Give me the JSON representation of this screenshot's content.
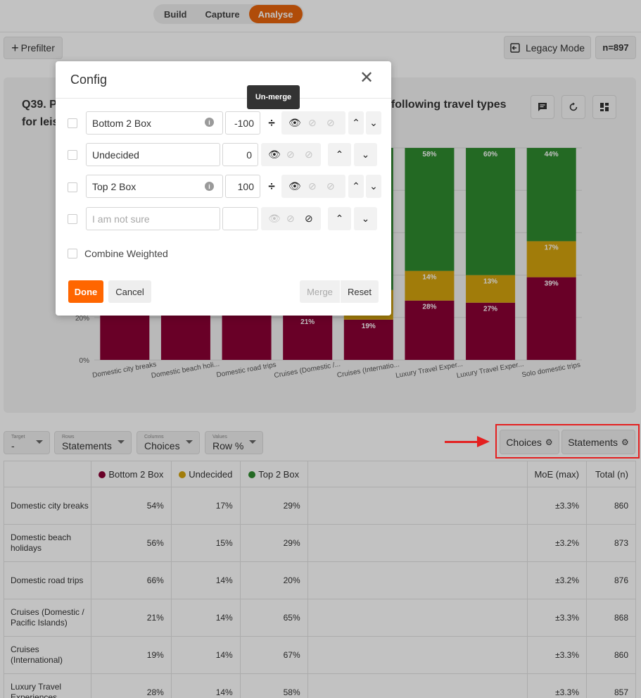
{
  "nav": {
    "tabs": [
      {
        "label": "Build"
      },
      {
        "label": "Capture"
      },
      {
        "label": "Analyse"
      }
    ]
  },
  "toolbar": {
    "prefilter_label": "Prefilter",
    "legacy_label": "Legacy Mode",
    "n_label": "n=897"
  },
  "card": {
    "title": "Q39. P... the following travel types for leis...",
    "title_line1_left": "Q39. P",
    "title_line1_right": "he following travel types",
    "title_line2": "for leis"
  },
  "colors": {
    "bottom2": "#8a0034",
    "undecided": "#d4a40e",
    "top2": "#2e8a2e",
    "accent": "#ff6600"
  },
  "chart_data": {
    "type": "bar",
    "stacked": true,
    "categories": [
      "Domestic city breaks",
      "Domestic beach holi...",
      "Domestic road trips",
      "Cruises (Domestic /...",
      "Cruises (Internatio...",
      "Luxury Travel Exper...",
      "Luxury Travel Exper...",
      "Solo domestic trips"
    ],
    "series": [
      {
        "name": "Bottom 2 Box",
        "values": [
          54,
          56,
          66,
          21,
          19,
          28,
          27,
          39
        ]
      },
      {
        "name": "Undecided",
        "values": [
          17,
          15,
          14,
          14,
          14,
          14,
          13,
          17
        ]
      },
      {
        "name": "Top 2 Box",
        "values": [
          29,
          29,
          20,
          65,
          67,
          58,
          60,
          44
        ]
      }
    ],
    "visible_labels": [
      {
        "cat": 3,
        "series": 0,
        "text": "21%"
      },
      {
        "cat": 4,
        "series": 0,
        "text": "19%"
      },
      {
        "cat": 5,
        "series": 0,
        "text": "28%"
      },
      {
        "cat": 5,
        "series": 1,
        "text": "14%"
      },
      {
        "cat": 5,
        "series": 2,
        "text": "58%"
      },
      {
        "cat": 6,
        "series": 0,
        "text": "27%"
      },
      {
        "cat": 6,
        "series": 1,
        "text": "13%"
      },
      {
        "cat": 6,
        "series": 2,
        "text": "60%"
      },
      {
        "cat": 7,
        "series": 0,
        "text": "39%"
      },
      {
        "cat": 7,
        "series": 1,
        "text": "17%"
      },
      {
        "cat": 7,
        "series": 2,
        "text": "44%"
      }
    ],
    "yticks": [
      "0%",
      "20%"
    ],
    "ylim": [
      0,
      100
    ]
  },
  "filters": [
    {
      "tiny": "Target",
      "value": "-"
    },
    {
      "tiny": "Rows",
      "value": "Statements"
    },
    {
      "tiny": "Columns",
      "value": "Choices"
    },
    {
      "tiny": "Values",
      "value": "Row %"
    }
  ],
  "choices_btn": "Choices",
  "statements_btn": "Statements",
  "table": {
    "headers": [
      "Bottom 2 Box",
      "Undecided",
      "Top 2 Box",
      "",
      "MoE (max)",
      "Total (n)"
    ],
    "rows": [
      {
        "label": "Domestic city breaks",
        "v": [
          "54%",
          "17%",
          "29%"
        ],
        "moe": "±3.3%",
        "total": "860"
      },
      {
        "label": "Domestic beach holidays",
        "v": [
          "56%",
          "15%",
          "29%"
        ],
        "moe": "±3.2%",
        "total": "873"
      },
      {
        "label": "Domestic road trips",
        "v": [
          "66%",
          "14%",
          "20%"
        ],
        "moe": "±3.2%",
        "total": "876"
      },
      {
        "label": "Cruises (Domestic / Pacific Islands)",
        "v": [
          "21%",
          "14%",
          "65%"
        ],
        "moe": "±3.3%",
        "total": "868"
      },
      {
        "label": "Cruises (International)",
        "v": [
          "19%",
          "14%",
          "67%"
        ],
        "moe": "±3.3%",
        "total": "860"
      },
      {
        "label": "Luxury Travel Experiences",
        "v": [
          "28%",
          "14%",
          "58%"
        ],
        "moe": "±3.3%",
        "total": "857"
      }
    ]
  },
  "modal": {
    "title": "Config",
    "tooltip": "Un-merge",
    "rows": [
      {
        "label": "Bottom 2 Box",
        "value": "-100"
      },
      {
        "label": "Undecided",
        "value": "0"
      },
      {
        "label": "Top 2 Box",
        "value": "100"
      },
      {
        "placeholder": "I am not sure",
        "value": ""
      }
    ],
    "combine_weighted": "Combine Weighted",
    "done": "Done",
    "cancel": "Cancel",
    "merge": "Merge",
    "reset": "Reset"
  }
}
